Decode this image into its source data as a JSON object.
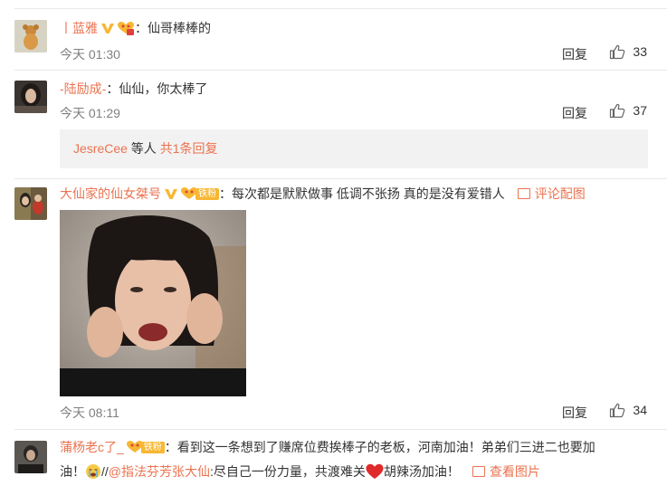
{
  "comments": [
    {
      "user": "丨蓝雅",
      "text": "：仙哥棒棒的",
      "time": "今天 01:30",
      "reply_label": "回复",
      "likes": "33"
    },
    {
      "user": "-陆励成-",
      "text": "：仙仙，你太棒了",
      "time": "今天 01:29",
      "reply_label": "回复",
      "likes": "37",
      "sub_replies": {
        "user": "JesreCee",
        "mid": " 等人 ",
        "link": "共1条回复"
      }
    },
    {
      "user": "大仙家的仙女桀号",
      "fan_label": "铁粉",
      "text": "：每次都是默默做事 低调不张扬 真的是没有爱错人",
      "pic_link": "评论配图",
      "time": "今天 08:11",
      "reply_label": "回复",
      "likes": "34"
    },
    {
      "user": "蒲杨老c了_",
      "fan_label": "铁粉",
      "text_line1": "：看到这一条想到了赚席位费挨棒子的老板，河南加油！弟弟们三进二也要加",
      "text_line2_a": "油！",
      "text_line2_b": "//",
      "mention": "@指法芬芳张大仙",
      "text_line2_c": ":尽自己一份力量，共渡难关",
      "text_line2_d": "胡辣汤加油！",
      "pic_link": "查看图片"
    }
  ],
  "colors": {
    "link": "#eb7350",
    "meta": "#808080",
    "reply_box_bg": "#f2f2f2"
  }
}
